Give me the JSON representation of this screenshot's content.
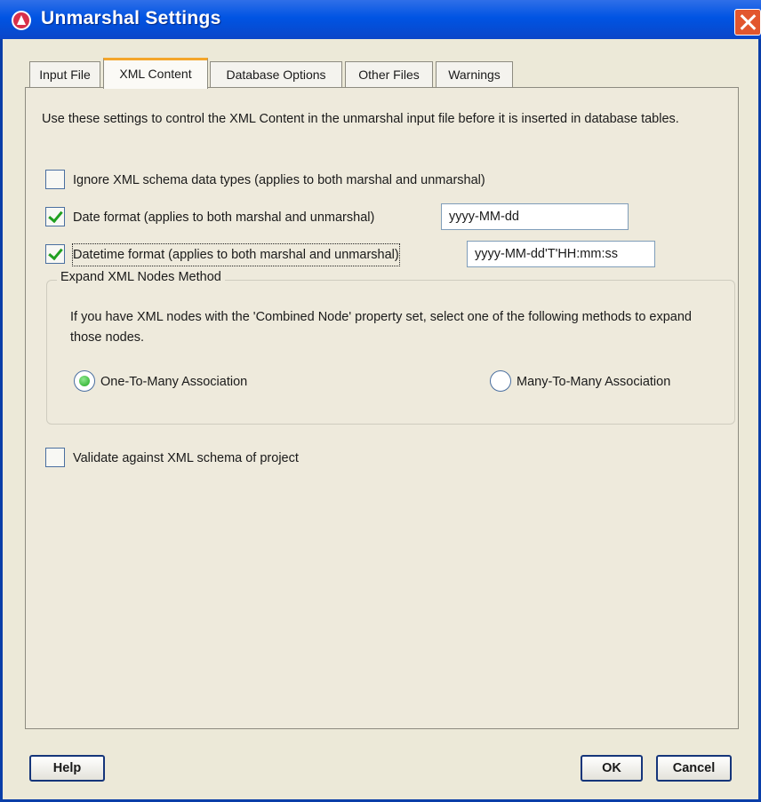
{
  "window": {
    "title": "Unmarshal Settings"
  },
  "tabs": [
    {
      "label": "Input File"
    },
    {
      "label": "XML Content"
    },
    {
      "label": "Database Options"
    },
    {
      "label": "Other Files"
    },
    {
      "label": "Warnings"
    }
  ],
  "active_tab": "XML Content",
  "content": {
    "intro": "Use these settings to control the XML Content in the unmarshal input file before it is inserted in database tables.",
    "ignore_schema": {
      "label": "Ignore XML schema data types (applies to both marshal and unmarshal)",
      "checked": false
    },
    "date_format": {
      "label": "Date format (applies to both marshal and unmarshal)",
      "checked": true,
      "value": "yyyy-MM-dd"
    },
    "datetime_format": {
      "label": "Datetime format (applies to both marshal and unmarshal)",
      "checked": true,
      "value": "yyyy-MM-dd'T'HH:mm:ss"
    },
    "expand_group": {
      "title": "Expand XML Nodes Method",
      "description": "If you have XML nodes with the 'Combined Node' property set, select one of the following methods to expand those nodes.",
      "option_one": {
        "label": "One-To-Many Association",
        "selected": true
      },
      "option_two": {
        "label": "Many-To-Many Association",
        "selected": false
      }
    },
    "validate": {
      "label": "Validate against XML schema of project",
      "checked": false
    }
  },
  "buttons": {
    "help": "Help",
    "ok": "OK",
    "cancel": "Cancel"
  },
  "icons": {
    "app": "app-logo-icon",
    "close": "close-icon"
  },
  "colors": {
    "titlebar": "#0054e3",
    "active_tab_accent": "#f4a62a",
    "check_green": "#20a020"
  }
}
